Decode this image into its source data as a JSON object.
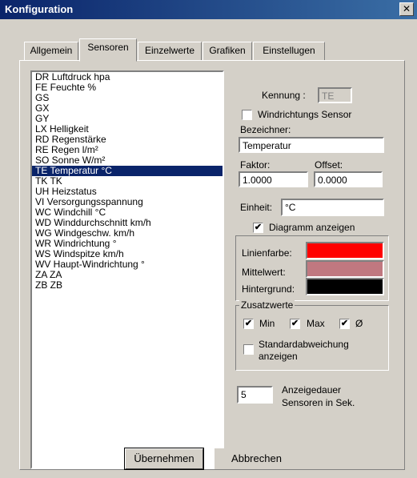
{
  "window": {
    "title": "Konfiguration",
    "close_glyph": "✕"
  },
  "tabs": [
    {
      "label": "Allgemein"
    },
    {
      "label": "Sensoren"
    },
    {
      "label": "Einzelwerte"
    },
    {
      "label": "Grafiken"
    },
    {
      "label": "Einstellugen"
    }
  ],
  "active_tab": "Sensoren",
  "sensors": [
    "DR  Luftdruck  hpa",
    "FE  Feuchte  %",
    "GS",
    "GX",
    "GY",
    "LX  Helligkeit",
    "RD  Regenstärke",
    "RE  Regen  l/m²",
    "SO  Sonne  W/m²",
    "TE  Temperatur  °C",
    "TK  TK",
    "UH  Heizstatus",
    "VI  Versorgungsspannung",
    "WC  Windchill  °C",
    "WD  Winddurchschnitt  km/h",
    "WG  Windgeschw.  km/h",
    "WR  Windrichtung  °",
    "WS  Windspitze  km/h",
    "WV  Haupt-Windrichtung  °",
    "ZA  ZA",
    "ZB  ZB"
  ],
  "selected_sensor_index": 9,
  "form": {
    "kennung_label": "Kennung :",
    "kennung_value": "TE",
    "windrichtung_label": "Windrichtungs Sensor",
    "windrichtung_checked": false,
    "bezeichner_label": "Bezeichner:",
    "bezeichner_value": "Temperatur",
    "faktor_label": "Faktor:",
    "faktor_value": "1.0000",
    "offset_label": "Offset:",
    "offset_value": "0.0000",
    "einheit_label": "Einheit:",
    "einheit_value": "°C",
    "diagramm_label": "Diagramm anzeigen",
    "diagramm_checked": true
  },
  "colors": {
    "linienfarbe_label": "Linienfarbe:",
    "linienfarbe": "#ff0000",
    "mittelwert_label": "Mittelwert:",
    "mittelwert": "#c07880",
    "hintergrund_label": "Hintergrund:",
    "hintergrund": "#000000"
  },
  "zusatzwerte": {
    "legend": "Zusatzwerte",
    "min_label": "Min",
    "min_checked": true,
    "max_label": "Max",
    "max_checked": true,
    "avg_label": "Ø",
    "avg_checked": true,
    "std_label_line1": "Standardabweichung",
    "std_label_line2": "anzeigen",
    "std_checked": false
  },
  "anzeigedauer": {
    "value": "5",
    "label_line1": "Anzeigedauer",
    "label_line2": "Sensoren in Sek."
  },
  "buttons": {
    "apply_label": "Übernehmen",
    "cancel_label": "Abbrechen"
  },
  "check_glyph": "✔"
}
